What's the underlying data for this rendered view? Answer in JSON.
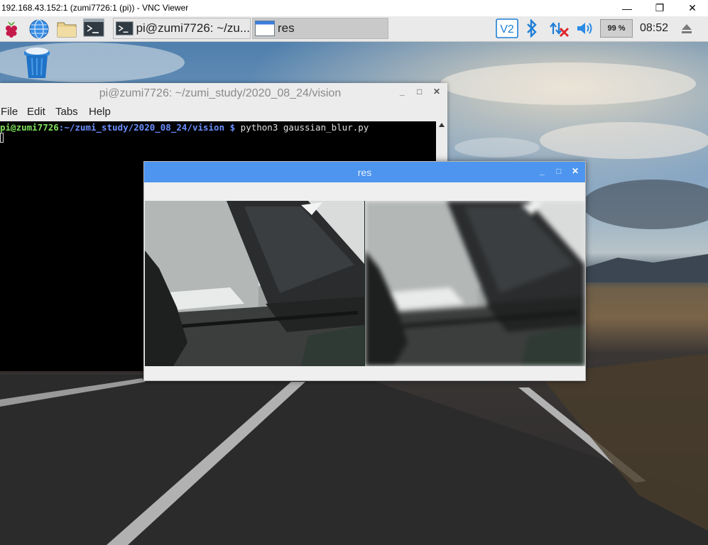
{
  "vnc": {
    "title": "192.168.43.152:1 (zumi7726:1 (pi)) - VNC Viewer",
    "minimize": "—",
    "maximize": "❐",
    "close": "✕"
  },
  "taskbar": {
    "tasks": [
      {
        "label": "pi@zumi7726: ~/zu...",
        "icon": "terminal-icon"
      },
      {
        "label": "res",
        "icon": "window-icon"
      }
    ],
    "tray": {
      "vnc_icon": "VNC",
      "bluetooth_icon": "bluetooth-icon",
      "network_icon": "network-disconnected-icon",
      "volume_icon": "volume-icon",
      "cpu_value": "99 %",
      "clock": "08:52",
      "eject_icon": "eject-icon"
    },
    "launchers": [
      "raspberry-menu-icon",
      "web-browser-icon",
      "file-manager-icon",
      "terminal-icon"
    ]
  },
  "desktop": {
    "icons": [
      {
        "name": "trash-icon"
      }
    ]
  },
  "terminal": {
    "title": "pi@zumi7726: ~/zumi_study/2020_08_24/vision",
    "controls": {
      "min": "_",
      "max": "□",
      "close": "✕"
    },
    "menu": [
      "File",
      "Edit",
      "Tabs",
      "Help"
    ],
    "prompt_user": "pi@zumi7726",
    "prompt_path": ":~/zumi_study/2020_08_24/vision $",
    "command": " python3 gaussian_blur.py"
  },
  "res_window": {
    "title": "res",
    "controls": {
      "min": "_",
      "max": "□",
      "close": "✕"
    }
  }
}
